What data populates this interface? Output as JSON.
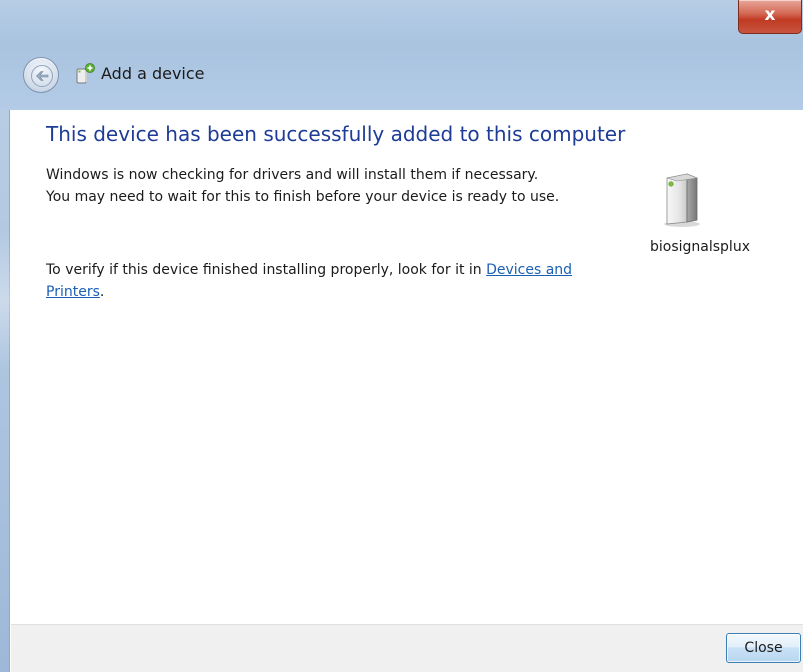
{
  "window": {
    "title": "Add a device",
    "close_glyph": "x"
  },
  "content": {
    "heading": "This device has been successfully added to this computer",
    "para1": "Windows is now checking for drivers and will install them if necessary. You may need to wait for this to finish before your device is ready to use.",
    "para2_prefix": "To verify if this device finished installing properly, look for it in ",
    "para2_link": "Devices and Printers",
    "para2_suffix": "."
  },
  "device": {
    "name": "biosignalsplux",
    "icon": "device-tower-icon"
  },
  "footer": {
    "close_label": "Close"
  },
  "icons": {
    "back": "back-arrow-icon",
    "title": "add-device-icon"
  },
  "colors": {
    "heading": "#1e3c96",
    "link": "#1a5fb4",
    "close_red": "#c13b23",
    "frame": "#a9c3e0"
  }
}
